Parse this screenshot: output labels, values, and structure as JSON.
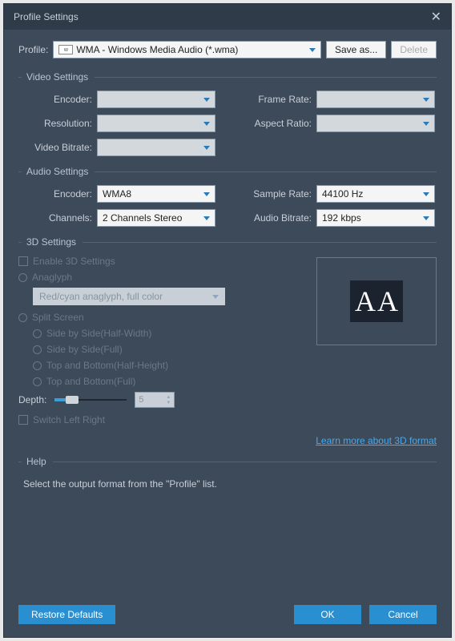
{
  "title": "Profile Settings",
  "profile": {
    "label": "Profile:",
    "value": "WMA - Windows Media Audio (*.wma)",
    "saveAs": "Save as...",
    "delete": "Delete"
  },
  "video": {
    "header": "Video Settings",
    "encoder": {
      "label": "Encoder:",
      "value": ""
    },
    "resolution": {
      "label": "Resolution:",
      "value": ""
    },
    "bitrate": {
      "label": "Video Bitrate:",
      "value": ""
    },
    "frameRate": {
      "label": "Frame Rate:",
      "value": ""
    },
    "aspectRatio": {
      "label": "Aspect Ratio:",
      "value": ""
    }
  },
  "audio": {
    "header": "Audio Settings",
    "encoder": {
      "label": "Encoder:",
      "value": "WMA8"
    },
    "channels": {
      "label": "Channels:",
      "value": "2 Channels Stereo"
    },
    "sampleRate": {
      "label": "Sample Rate:",
      "value": "44100 Hz"
    },
    "bitrate": {
      "label": "Audio Bitrate:",
      "value": "192 kbps"
    }
  },
  "threed": {
    "header": "3D Settings",
    "enable": "Enable 3D Settings",
    "anaglyph": "Anaglyph",
    "anaglyphMode": "Red/cyan anaglyph, full color",
    "splitScreen": "Split Screen",
    "sbsHalf": "Side by Side(Half-Width)",
    "sbsFull": "Side by Side(Full)",
    "tabHalf": "Top and Bottom(Half-Height)",
    "tabFull": "Top and Bottom(Full)",
    "depthLabel": "Depth:",
    "depthValue": "5",
    "switchLR": "Switch Left Right",
    "learnMore": "Learn more about 3D format",
    "previewA": "A"
  },
  "help": {
    "header": "Help",
    "text": "Select the output format from the \"Profile\" list."
  },
  "footer": {
    "restore": "Restore Defaults",
    "ok": "OK",
    "cancel": "Cancel"
  }
}
